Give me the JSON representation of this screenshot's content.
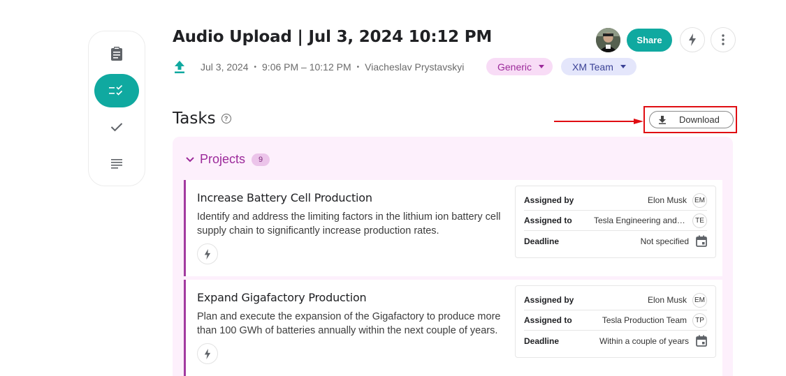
{
  "header": {
    "title": "Audio Upload | Jul 3, 2024 10:12 PM",
    "date": "Jul 3, 2024",
    "time_range": "9:06 PM – 10:12 PM",
    "author": "Viacheslav Prystavskyi",
    "separator": "•",
    "chips": [
      {
        "label": "Generic"
      },
      {
        "label": "XM Team"
      }
    ],
    "share_label": "Share",
    "icons": {
      "upload": "upload-icon",
      "bolt": "lightning-icon",
      "more": "more-vertical-icon",
      "avatar": "user-avatar"
    }
  },
  "rail": {
    "items": [
      {
        "icon": "clipboard-icon",
        "active": false
      },
      {
        "icon": "task-list-icon",
        "active": true
      },
      {
        "icon": "checkmark-icon",
        "active": false
      },
      {
        "icon": "text-lines-icon",
        "active": false
      }
    ]
  },
  "tasks": {
    "title": "Tasks",
    "help": "?",
    "download_label": "Download"
  },
  "projects": {
    "label": "Projects",
    "count": "9",
    "items": [
      {
        "title": "Increase Battery Cell Production",
        "description": "Identify and address the limiting factors in the lithium ion battery cell supply chain to significantly increase production rates.",
        "assigned_by_label": "Assigned by",
        "assigned_by": "Elon Musk",
        "assigned_by_initials": "EM",
        "assigned_to_label": "Assigned to",
        "assigned_to": "Tesla Engineering and Production Teams",
        "assigned_to_initials": "TE",
        "deadline_label": "Deadline",
        "deadline": "Not specified"
      },
      {
        "title": "Expand Gigafactory Production",
        "description": "Plan and execute the expansion of the Gigafactory to produce more than 100 GWh of batteries annually within the next couple of years.",
        "assigned_by_label": "Assigned by",
        "assigned_by": "Elon Musk",
        "assigned_by_initials": "EM",
        "assigned_to_label": "Assigned to",
        "assigned_to": "Tesla Production Team",
        "assigned_to_initials": "TP",
        "deadline_label": "Deadline",
        "deadline": "Within a couple of years"
      }
    ]
  },
  "colors": {
    "accent": "#10a9a0",
    "project": "#9c2a9a",
    "panel": "#fdf0fc",
    "highlight": "#e00d12"
  }
}
